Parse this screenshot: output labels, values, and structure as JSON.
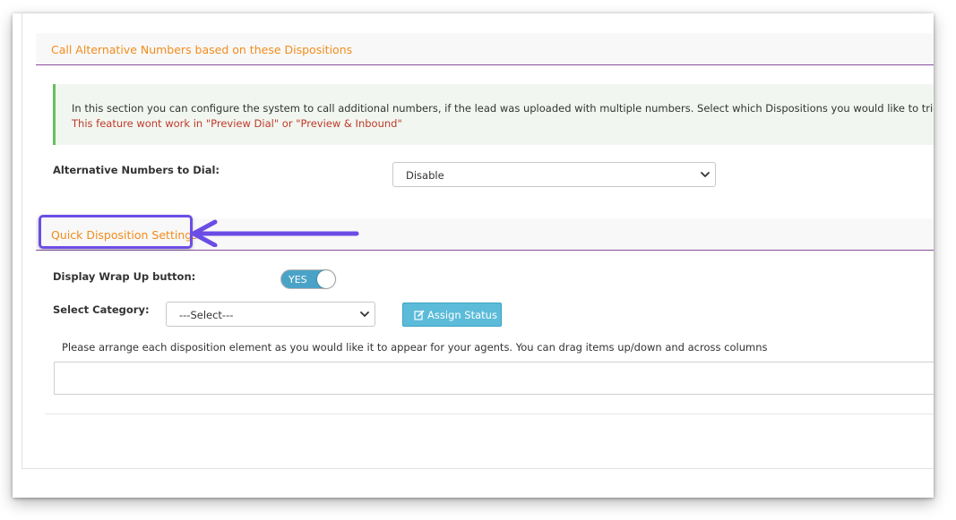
{
  "alt_section": {
    "title": "Call Alternative Numbers based on these Dispositions",
    "info_text": "In this section you can configure the system to call additional numbers, if the lead was uploaded with multiple numbers. Select which Dispositions you would like to trigger calling",
    "warning_text": "This feature wont work in \"Preview Dial\" or \"Preview & Inbound\"",
    "alt_numbers_label": "Alternative Numbers to Dial:",
    "alt_numbers_value": "Disable"
  },
  "quick_section": {
    "title": "Quick Disposition Settings",
    "wrap_up_label": "Display Wrap Up button:",
    "wrap_up_toggle": "YES",
    "category_label": "Select Category:",
    "category_value": "---Select---",
    "assign_button": "Assign Status",
    "hint_text": "Please arrange each disposition element as you would like it to appear for your agents. You can drag items up/down and across columns"
  },
  "colors": {
    "section_title": "#f28c1c",
    "section_rule": "#8a4f9e",
    "info_border": "#64c15b",
    "warning": "#c0392b",
    "toggle": "#4aa3c7",
    "button": "#5bbbd9",
    "annotation": "#6b4de6"
  },
  "icons": {
    "dropdown": "chevron-down-icon",
    "assign": "edit-icon",
    "annotation": "arrow-left-icon"
  }
}
